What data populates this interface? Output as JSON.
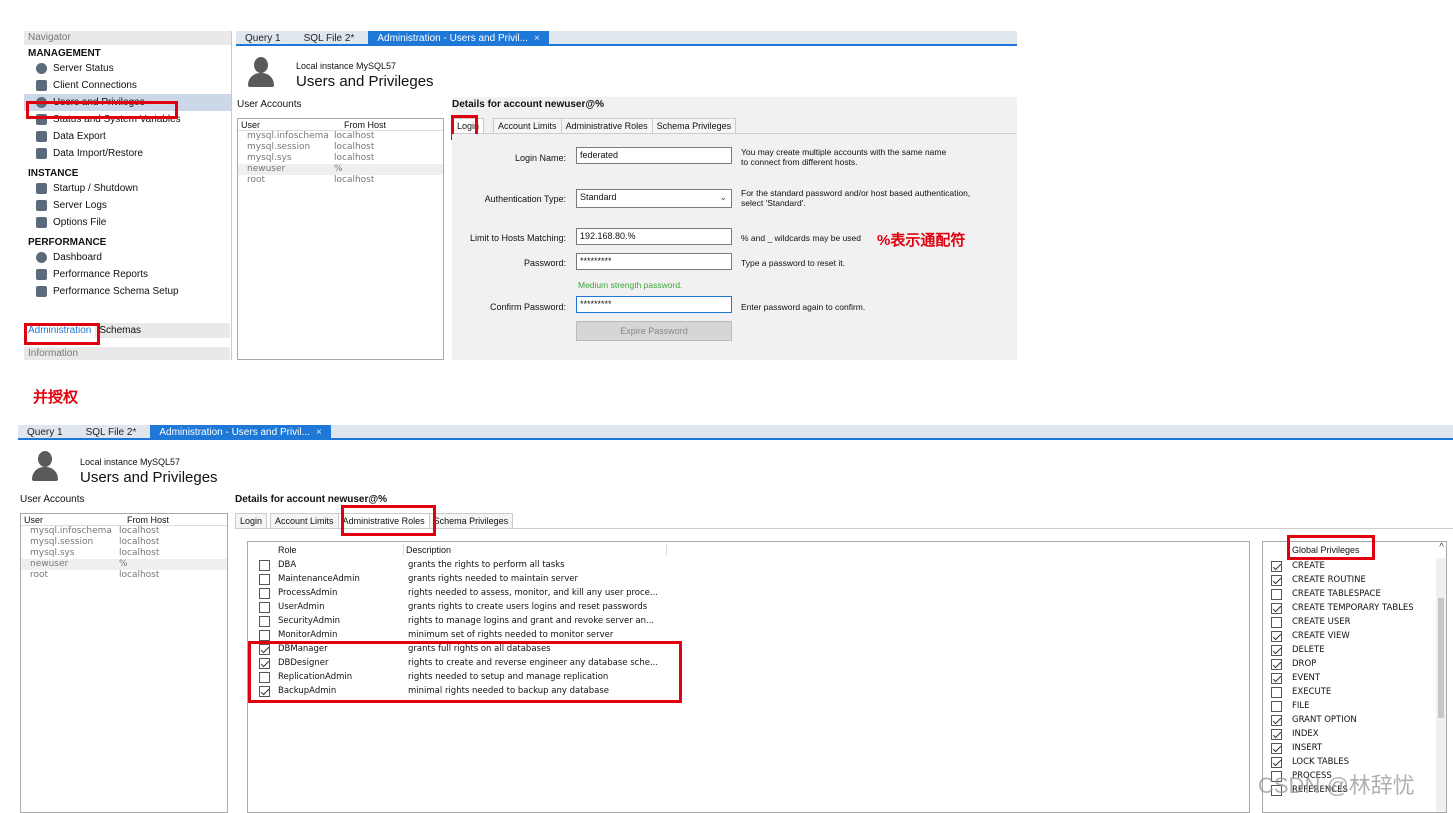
{
  "top": {
    "tabs": [
      {
        "label": "Query 1",
        "active": false
      },
      {
        "label": "SQL File 2*",
        "active": false
      },
      {
        "label": "Administration - Users and Privil...",
        "active": true
      }
    ],
    "close_glyph": "×"
  },
  "navigator": {
    "header": "Navigator",
    "sections": {
      "management": "MANAGEMENT",
      "instance": "INSTANCE",
      "performance": "PERFORMANCE"
    },
    "management_items": [
      "Server Status",
      "Client Connections",
      "Users and Privileges",
      "Status and System Variables",
      "Data Export",
      "Data Import/Restore"
    ],
    "instance_items": [
      "Startup / Shutdown",
      "Server Logs",
      "Options File"
    ],
    "performance_items": [
      "Dashboard",
      "Performance Reports",
      "Performance Schema Setup"
    ],
    "bottom_tabs": [
      "Administration",
      "Schemas"
    ],
    "info": "Information"
  },
  "instance": {
    "small": "Local instance MySQL57",
    "big": "Users and Privileges"
  },
  "user_accounts": {
    "title": "User Accounts",
    "columns": [
      "User",
      "From Host"
    ],
    "rows": [
      {
        "user": "mysql.infoschema",
        "host": "localhost"
      },
      {
        "user": "mysql.session",
        "host": "localhost"
      },
      {
        "user": "mysql.sys",
        "host": "localhost"
      },
      {
        "user": "newuser",
        "host": "%"
      },
      {
        "user": "root",
        "host": "localhost"
      }
    ]
  },
  "details": {
    "title": "Details for account newuser@%",
    "tabs": [
      "Login",
      "Account Limits",
      "Administrative Roles",
      "Schema Privileges"
    ]
  },
  "login": {
    "login_name_label": "Login Name:",
    "login_name_value": "federated",
    "login_name_hint": "You may create multiple accounts with the same name\nto connect from different hosts.",
    "auth_label": "Authentication Type:",
    "auth_value": "Standard",
    "auth_hint": "For the standard password and/or host based authentication,\nselect 'Standard'.",
    "hosts_label": "Limit to Hosts Matching:",
    "hosts_value": "192.168.80.%",
    "hosts_hint": "% and _ wildcards may be used",
    "annotation": "%表示通配符",
    "password_label": "Password:",
    "password_value": "*********",
    "password_hint": "Type a password to reset it.",
    "strength": "Medium strength password.",
    "confirm_label": "Confirm Password:",
    "confirm_value": "*********",
    "confirm_hint": "Enter password again to confirm.",
    "expire_button": "Expire Password"
  },
  "middle_annotation": "并授权",
  "roles": {
    "col_role": "Role",
    "col_desc": "Description",
    "rows": [
      {
        "role": "DBA",
        "desc": "grants the rights to perform all tasks",
        "checked": false
      },
      {
        "role": "MaintenanceAdmin",
        "desc": "grants rights needed to maintain server",
        "checked": false
      },
      {
        "role": "ProcessAdmin",
        "desc": "rights needed to assess, monitor, and kill any user proce...",
        "checked": false
      },
      {
        "role": "UserAdmin",
        "desc": "grants rights to create users logins and reset passwords",
        "checked": false
      },
      {
        "role": "SecurityAdmin",
        "desc": "rights to manage logins and grant and revoke server an...",
        "checked": false
      },
      {
        "role": "MonitorAdmin",
        "desc": "minimum set of rights needed to monitor server",
        "checked": false
      },
      {
        "role": "DBManager",
        "desc": "grants full rights on all databases",
        "checked": true
      },
      {
        "role": "DBDesigner",
        "desc": "rights to create and reverse engineer any database sche...",
        "checked": true
      },
      {
        "role": "ReplicationAdmin",
        "desc": "rights needed to setup and manage replication",
        "checked": false
      },
      {
        "role": "BackupAdmin",
        "desc": "minimal rights needed to backup any database",
        "checked": true
      }
    ]
  },
  "global_privileges": {
    "title": "Global Privileges",
    "items": [
      {
        "name": "CREATE",
        "checked": true
      },
      {
        "name": "CREATE ROUTINE",
        "checked": true
      },
      {
        "name": "CREATE TABLESPACE",
        "checked": false
      },
      {
        "name": "CREATE TEMPORARY TABLES",
        "checked": true
      },
      {
        "name": "CREATE USER",
        "checked": false
      },
      {
        "name": "CREATE VIEW",
        "checked": true
      },
      {
        "name": "DELETE",
        "checked": true
      },
      {
        "name": "DROP",
        "checked": true
      },
      {
        "name": "EVENT",
        "checked": true
      },
      {
        "name": "EXECUTE",
        "checked": false
      },
      {
        "name": "FILE",
        "checked": false
      },
      {
        "name": "GRANT OPTION",
        "checked": true
      },
      {
        "name": "INDEX",
        "checked": true
      },
      {
        "name": "INSERT",
        "checked": true
      },
      {
        "name": "LOCK TABLES",
        "checked": true
      },
      {
        "name": "PROCESS",
        "checked": false
      },
      {
        "name": "REFERENCES",
        "checked": false
      }
    ]
  },
  "watermark": "CSDN @林辞忧",
  "colors": {
    "accent": "#1e78d7",
    "annotation_red": "#e0000e",
    "strength_green": "#3aa63a"
  }
}
